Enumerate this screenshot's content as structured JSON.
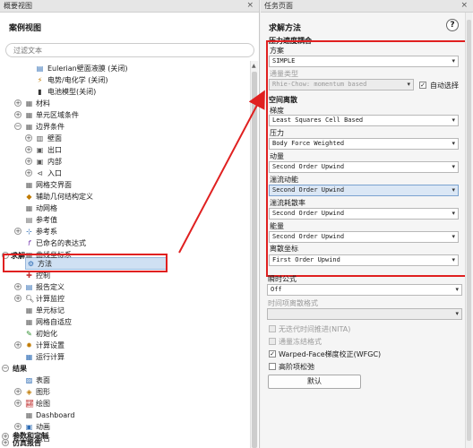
{
  "left_panel": {
    "title": "概要视图",
    "close": "×",
    "section_title": "案例视图",
    "filter_placeholder": "过滤文本"
  },
  "tree": {
    "eulerian_wall_film": "Eulerian壁面液膜 (关闭)",
    "potential": "电势/电化学 (关闭)",
    "battery": "电池模型(关闭)",
    "materials": "材料",
    "cell_zone": "单元区域条件",
    "boundary": "边界条件",
    "wall": "壁面",
    "outlet": "出口",
    "interior": "内部",
    "inlet": "入口",
    "mesh_interface": "网格交界面",
    "geom": "辅助几何结构定义",
    "dynamic_mesh": "动网格",
    "ref_values": "参考值",
    "ref_frames": "参考系",
    "named_expr": "已命名的表达式",
    "curvilinear": "曲线坐标系",
    "solution_cat": "求解",
    "methods": "方法",
    "controls": "控制",
    "report_def": "报告定义",
    "monitors": "计算监控",
    "cell_registers": "单元标记",
    "mesh_adapt": "网格自适应",
    "init": "初始化",
    "calc_activities": "计算设置",
    "run_calc": "运行计算",
    "results_cat": "结果",
    "surfaces": "表面",
    "graphics": "图形",
    "plots": "绘图",
    "dashboard": "Dashboard",
    "animations": "动画",
    "reports": "报告",
    "params_cat": "参数和定制",
    "sim_reports_cat": "仿真报告"
  },
  "right_panel": {
    "title": "任务页面",
    "close": "×",
    "solution_methods": "求解方法",
    "help": "?",
    "pv_coupling": "压力速度耦合",
    "scheme_label": "方案",
    "scheme_value": "SIMPLE",
    "flux_type_label": "通量类型",
    "flux_type_value": "Rhie-Chow: momentum based",
    "auto_select": "自动选择",
    "spatial_disc": "空间离散",
    "gradient_label": "梯度",
    "gradient_value": "Least Squares Cell Based",
    "pressure_label": "压力",
    "pressure_value": "Body Force Weighted",
    "momentum_label": "动量",
    "momentum_value": "Second Order Upwind",
    "tke_label": "湍流动能",
    "tke_value": "Second Order Upwind",
    "tdr_label": "湍流耗散率",
    "tdr_value": "Second Order Upwind",
    "energy_label": "能量",
    "energy_value": "Second Order Upwind",
    "discrete_ord_label": "离散坐标",
    "discrete_ord_value": "First Order Upwind",
    "transient_label": "瞬时公式",
    "transient_value": "Off",
    "time_disc_label": "时间项离散格式",
    "time_disc_value": "",
    "nita": "无迭代时间推进(NITA)",
    "frozen_flux": "通量冻结格式",
    "wfgc": "Warped-Face梯度校正(WFGC)",
    "high_order": "高阶项松弛",
    "default_button": "默认"
  },
  "colors": {
    "highlight_red": "#e02020",
    "selection_blue": "#cfe0f3"
  }
}
